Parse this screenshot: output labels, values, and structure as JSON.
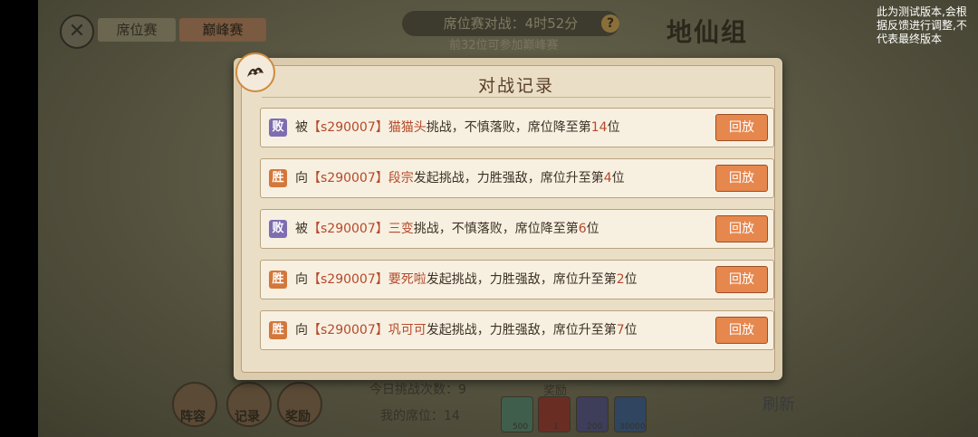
{
  "header": {
    "tabs": [
      {
        "label": "席位赛"
      },
      {
        "label": "巅峰赛"
      }
    ],
    "timer_text": "席位赛对战：4时52分",
    "timer_sub": "前32位可参加巅峰赛",
    "group_title": "地仙组",
    "test_notice": "此为测试版本,会根据反馈进行调整,不代表最终版本"
  },
  "background": {
    "bottom_buttons": [
      {
        "label": "阵容"
      },
      {
        "label": "记录"
      },
      {
        "label": "奖励"
      }
    ],
    "challenge_count_label": "今日挑战次数：9",
    "my_seat_label": "我的席位：14",
    "reward_label": "奖励",
    "reward_counts": [
      "500",
      "1",
      "200",
      "30000"
    ],
    "refresh_label": "刷新"
  },
  "dialog": {
    "title": "对战记录",
    "records": [
      {
        "result": "败",
        "type": "lose",
        "prefix": "被",
        "server_id": "【s290007】",
        "name": "猫猫头",
        "action": "挑战，不慎落败，席位降至第",
        "rank": "14",
        "suffix": "位",
        "replay_label": "回放"
      },
      {
        "result": "胜",
        "type": "win",
        "prefix": "向",
        "server_id": "【s290007】",
        "name": "段宗",
        "action": "发起挑战，力胜强敌，席位升至第",
        "rank": "4",
        "suffix": "位",
        "replay_label": "回放"
      },
      {
        "result": "败",
        "type": "lose",
        "prefix": "被",
        "server_id": "【s290007】",
        "name": "三变",
        "action": "挑战，不慎落败，席位降至第",
        "rank": "6",
        "suffix": "位",
        "replay_label": "回放"
      },
      {
        "result": "胜",
        "type": "win",
        "prefix": "向",
        "server_id": "【s290007】",
        "name": "要死啦",
        "action": "发起挑战，力胜强敌，席位升至第",
        "rank": "2",
        "suffix": "位",
        "replay_label": "回放"
      },
      {
        "result": "胜",
        "type": "win",
        "prefix": "向",
        "server_id": "【s290007】",
        "name": "巩可可",
        "action": "发起挑战，力胜强敌，席位升至第",
        "rank": "7",
        "suffix": "位",
        "replay_label": "回放"
      }
    ]
  },
  "colors": {
    "accent_orange": "#e6874e",
    "lose_badge": "#7e6db0",
    "win_badge": "#d4773a",
    "highlight_text": "#b5492a"
  },
  "icons": {
    "close": "close-icon",
    "help": "help-icon",
    "dialog_emblem": "tiger-emblem-icon"
  }
}
